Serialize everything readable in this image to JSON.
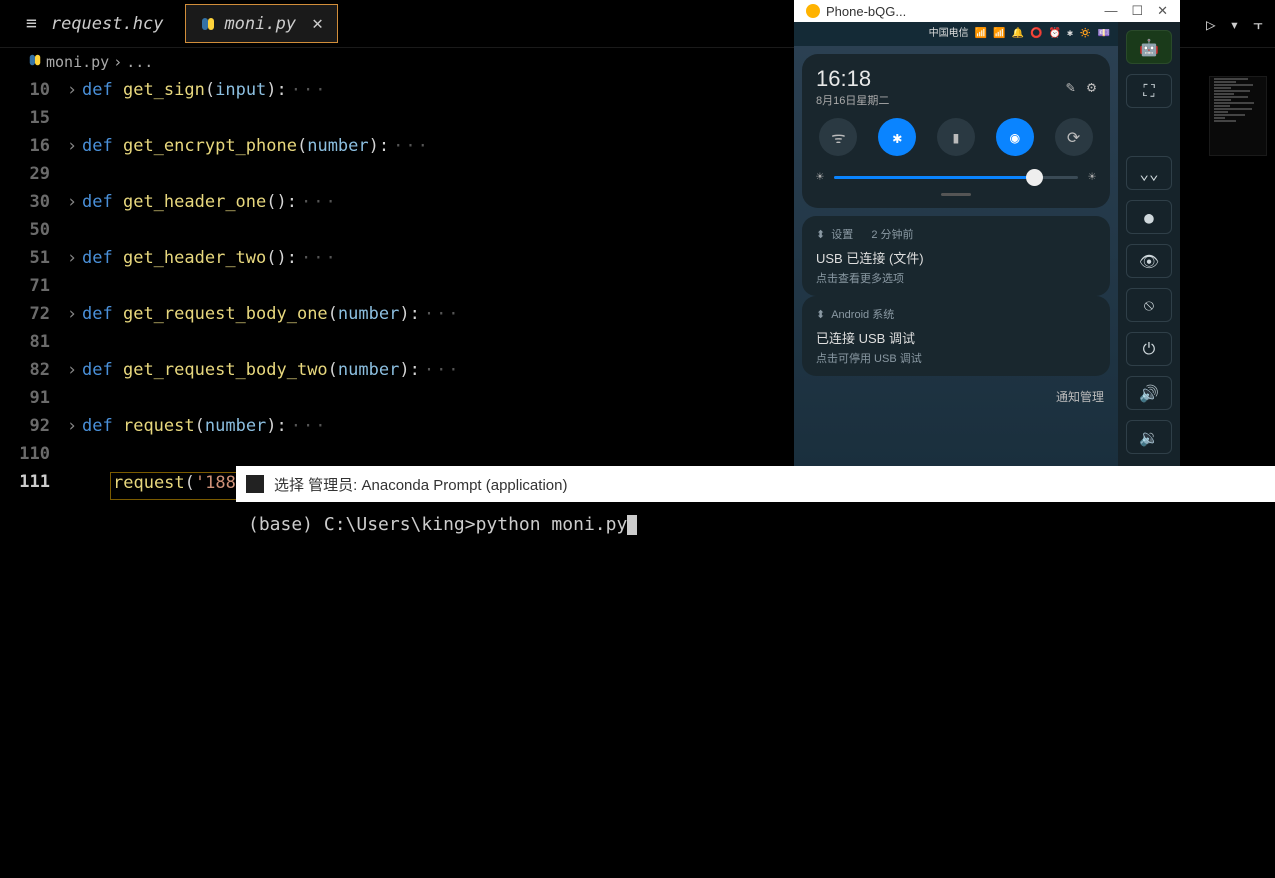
{
  "tabs": [
    {
      "label": "request.hcy",
      "icon": "≡",
      "active": false
    },
    {
      "label": "moni.py",
      "icon": "py",
      "active": true,
      "closeable": true
    }
  ],
  "breadcrumb": {
    "file": "moni.py",
    "sep": "›",
    "rest": "..."
  },
  "code_lines": [
    {
      "ln": "10",
      "fold": true,
      "def": "def",
      "fn": "get_sign",
      "params": "input",
      "collapsed": true
    },
    {
      "ln": "15",
      "fold": false
    },
    {
      "ln": "16",
      "fold": true,
      "def": "def",
      "fn": "get_encrypt_phone",
      "params": "number",
      "collapsed": true
    },
    {
      "ln": "29",
      "fold": false
    },
    {
      "ln": "30",
      "fold": true,
      "def": "def",
      "fn": "get_header_one",
      "params": "",
      "collapsed": true
    },
    {
      "ln": "50",
      "fold": false
    },
    {
      "ln": "51",
      "fold": true,
      "def": "def",
      "fn": "get_header_two",
      "params": "",
      "collapsed": true
    },
    {
      "ln": "71",
      "fold": false
    },
    {
      "ln": "72",
      "fold": true,
      "def": "def",
      "fn": "get_request_body_one",
      "params": "number",
      "collapsed": true
    },
    {
      "ln": "81",
      "fold": false
    },
    {
      "ln": "82",
      "fold": true,
      "def": "def",
      "fn": "get_request_body_two",
      "params": "number",
      "collapsed": true
    },
    {
      "ln": "91",
      "fold": false
    },
    {
      "ln": "92",
      "fold": true,
      "def": "def",
      "fn": "request",
      "params": "number",
      "collapsed": true
    },
    {
      "ln": "110",
      "fold": false
    },
    {
      "ln": "111",
      "fold": false,
      "highlighted": true,
      "call_fn": "request",
      "call_arg": "'188"
    }
  ],
  "terminal": {
    "title_prefix": "选择 管理员:",
    "title_main": "Anaconda Prompt (application)",
    "full_title": "选择 管理员: Anaconda Prompt (application)",
    "prompt": "(base) C:\\Users\\king>",
    "command": "python moni.py"
  },
  "phone": {
    "window_title": "Phone-bQG...",
    "statusbar": "中国电信 📶 📶 🔔 ⭕   ⏰ ✱ 🔅 💷",
    "time": "16:18",
    "date": "8月16日星期二",
    "tiles": [
      {
        "icon": "wifi",
        "on": false,
        "glyph": "📶"
      },
      {
        "icon": "bluetooth",
        "on": true,
        "glyph": "✱"
      },
      {
        "icon": "flashlight",
        "on": false,
        "glyph": "🔦"
      },
      {
        "icon": "vibrate",
        "on": true,
        "glyph": "📳"
      },
      {
        "icon": "rotate",
        "on": false,
        "glyph": "🔄"
      }
    ],
    "brightness_pct": 82,
    "notifications": [
      {
        "app": "设置",
        "time": "2 分钟前",
        "title": "USB 已连接 (文件)",
        "sub": "点击查看更多选项"
      },
      {
        "app": "Android 系统",
        "time": "",
        "title": "已连接 USB 调试",
        "sub": "点击可停用 USB 调试"
      }
    ],
    "manage_label": "通知管理",
    "sidebar_icons": [
      "android",
      "fullscreen",
      "gap",
      "chevrons-down",
      "circle",
      "eye",
      "eye-off",
      "power",
      "volume-up",
      "volume-down"
    ]
  },
  "top_toolbar": {
    "run_icon": "▷",
    "dropdown_icon": "▾",
    "split_icon": "⫟"
  }
}
